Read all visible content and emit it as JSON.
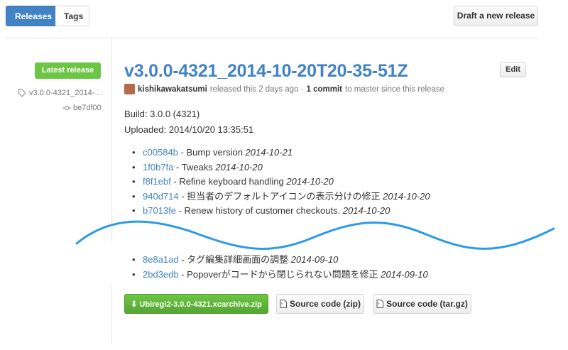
{
  "tabs": {
    "releases": "Releases",
    "tags": "Tags"
  },
  "actions": {
    "draft": "Draft a new release",
    "edit": "Edit"
  },
  "sidebar": {
    "badge": "Latest release",
    "tag": "v3.0.0-4321_2014-…",
    "commit": "be7df00"
  },
  "release": {
    "title": "v3.0.0-4321_2014-10-20T20-35-51Z",
    "author": "kishikawakatsumi",
    "released_text": "released this 2 days ago ·",
    "commit_count": "1 commit",
    "since_text": "to master since this release",
    "build": "Build: 3.0.0 (4321)",
    "uploaded": "Uploaded: 2014/10/20 13:35:51"
  },
  "commits_top": [
    {
      "sha": "c00584b",
      "msg": " - Bump version ",
      "date": "2014-10-21"
    },
    {
      "sha": "1f0b7fa",
      "msg": " - Tweaks ",
      "date": "2014-10-20"
    },
    {
      "sha": "f8f1ebf",
      "msg": " - Refine keyboard handling ",
      "date": "2014-10-20"
    },
    {
      "sha": "940d714",
      "msg": " - 担当者のデフォルトアイコンの表示分けの修正 ",
      "date": "2014-10-20"
    },
    {
      "sha": "b7013fe",
      "msg": " - Renew history of customer checkouts. ",
      "date": "2014-10-20"
    }
  ],
  "commits_bottom": [
    {
      "sha": "8e8a1ad",
      "msg": " - タグ編集詳細画面の調整 ",
      "date": "2014-09-10"
    },
    {
      "sha": "2bd3edb",
      "msg": " - Popoverがコードから閉じられない問題を修正 ",
      "date": "2014-09-10"
    }
  ],
  "downloads": {
    "primary": "Ubiregi2-3.0.0-4321.xcarchive.zip",
    "zip": "Source code (zip)",
    "targz": "Source code (tar.gz)"
  },
  "colors": {
    "link": "#4183c4",
    "green": "#6cc644",
    "wave": "#2b9be6"
  },
  "icons": [
    "tag-icon",
    "commit-icon",
    "download-icon",
    "file-zip-icon"
  ]
}
